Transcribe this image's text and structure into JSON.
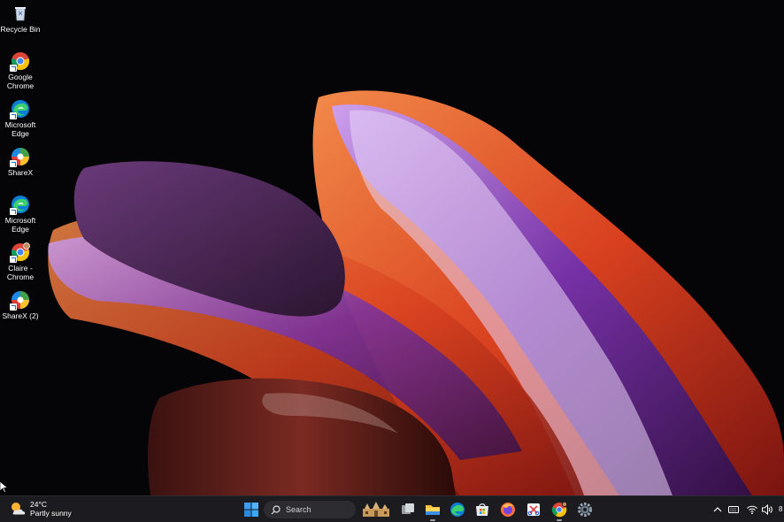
{
  "desktop": {
    "icons": [
      {
        "label": "Recycle Bin",
        "icon": "recycle-bin-icon"
      },
      {
        "label": "Google\nChrome",
        "icon": "chrome-icon"
      },
      {
        "label": "Microsoft\nEdge",
        "icon": "edge-icon"
      },
      {
        "label": "ShareX",
        "icon": "sharex-icon"
      },
      {
        "label": "Microsoft\nEdge",
        "icon": "edge-icon"
      },
      {
        "label": "Claire -\nChrome",
        "icon": "chrome-profile-icon"
      },
      {
        "label": "ShareX (2)",
        "icon": "sharex-icon"
      }
    ]
  },
  "taskbar": {
    "weather": {
      "temperature": "24°C",
      "condition": "Partly sunny",
      "icon": "partly-sunny-icon"
    },
    "search": {
      "placeholder": "Search"
    },
    "pinned": [
      "start-icon",
      "search-icon",
      "search-highlight-icon",
      "task-view-icon",
      "file-explorer-icon",
      "edge-icon",
      "microsoft-store-icon",
      "firefox-icon",
      "snipping-tool-icon",
      "chrome-icon",
      "settings-icon"
    ],
    "tray": [
      "chevron-up-icon",
      "keyboard-icon",
      "wifi-icon",
      "speaker-icon"
    ],
    "clock_partial": "8"
  },
  "colors": {
    "taskbar_bg": "#1c1b1f",
    "wallpaper_bg": "#050406",
    "accent_orange": "#e8552a",
    "accent_purple": "#6a2fb0"
  }
}
